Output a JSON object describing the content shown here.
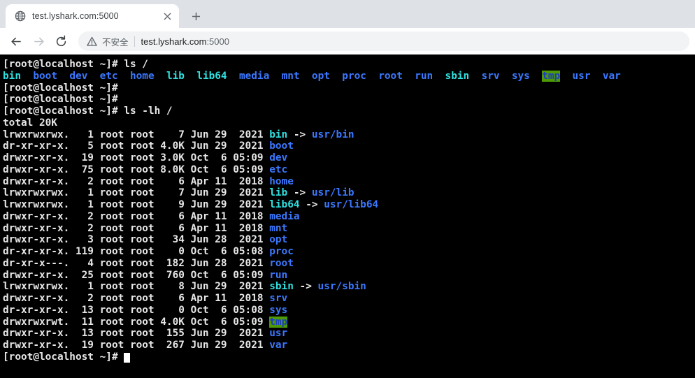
{
  "browser": {
    "tab": {
      "title": "test.lyshark.com:5000",
      "favicon": "globe-icon",
      "close": "close-icon"
    },
    "new_tab_label": "+",
    "nav": {
      "back": "back-arrow-icon",
      "forward": "forward-arrow-icon",
      "reload": "reload-icon"
    },
    "omnibox": {
      "security_icon": "warning-triangle-icon",
      "security_text": "不安全",
      "url_host": "test.lyshark.com",
      "url_port": ":5000",
      "url_full": "test.lyshark.com:5000"
    }
  },
  "terminal": {
    "prompt": "[root@localhost ~]# ",
    "cursor": "block-cursor",
    "background": "#000000",
    "colors": {
      "text": "#e6e6e6",
      "directory": "#3b78ff",
      "symlink": "#2ee0e0",
      "sticky_dir_fg": "#1c3fbf",
      "sticky_dir_bg": "#4e9a06"
    },
    "lines": [
      {
        "type": "prompt",
        "command": "ls /"
      },
      {
        "type": "ls-columns",
        "entries": [
          {
            "name": "bin",
            "kind": "symlink"
          },
          {
            "name": "boot",
            "kind": "dir"
          },
          {
            "name": "dev",
            "kind": "dir"
          },
          {
            "name": "etc",
            "kind": "dir"
          },
          {
            "name": "home",
            "kind": "dir"
          },
          {
            "name": "lib",
            "kind": "symlink"
          },
          {
            "name": "lib64",
            "kind": "symlink"
          },
          {
            "name": "media",
            "kind": "dir"
          },
          {
            "name": "mnt",
            "kind": "dir"
          },
          {
            "name": "opt",
            "kind": "dir"
          },
          {
            "name": "proc",
            "kind": "dir"
          },
          {
            "name": "root",
            "kind": "dir"
          },
          {
            "name": "run",
            "kind": "dir"
          },
          {
            "name": "sbin",
            "kind": "symlink"
          },
          {
            "name": "srv",
            "kind": "dir"
          },
          {
            "name": "sys",
            "kind": "dir"
          },
          {
            "name": "tmp",
            "kind": "sticky"
          },
          {
            "name": "usr",
            "kind": "dir"
          },
          {
            "name": "var",
            "kind": "dir"
          }
        ]
      },
      {
        "type": "prompt",
        "command": ""
      },
      {
        "type": "prompt",
        "command": ""
      },
      {
        "type": "prompt",
        "command": "ls -lh /"
      },
      {
        "type": "plain",
        "text": "total 20K"
      },
      {
        "type": "ls-long",
        "perms": "lrwxrwxrwx.",
        "links": "1",
        "owner": "root",
        "group": "root",
        "size": "7",
        "month": "Jun",
        "day": "29",
        "time": "2021",
        "name": "bin",
        "kind": "symlink",
        "target": "usr/bin"
      },
      {
        "type": "ls-long",
        "perms": "dr-xr-xr-x.",
        "links": "5",
        "owner": "root",
        "group": "root",
        "size": "4.0K",
        "month": "Jun",
        "day": "29",
        "time": "2021",
        "name": "boot",
        "kind": "dir"
      },
      {
        "type": "ls-long",
        "perms": "drwxr-xr-x.",
        "links": "19",
        "owner": "root",
        "group": "root",
        "size": "3.0K",
        "month": "Oct",
        "day": "6",
        "time": "05:09",
        "name": "dev",
        "kind": "dir"
      },
      {
        "type": "ls-long",
        "perms": "drwxr-xr-x.",
        "links": "75",
        "owner": "root",
        "group": "root",
        "size": "8.0K",
        "month": "Oct",
        "day": "6",
        "time": "05:09",
        "name": "etc",
        "kind": "dir"
      },
      {
        "type": "ls-long",
        "perms": "drwxr-xr-x.",
        "links": "2",
        "owner": "root",
        "group": "root",
        "size": "6",
        "month": "Apr",
        "day": "11",
        "time": "2018",
        "name": "home",
        "kind": "dir"
      },
      {
        "type": "ls-long",
        "perms": "lrwxrwxrwx.",
        "links": "1",
        "owner": "root",
        "group": "root",
        "size": "7",
        "month": "Jun",
        "day": "29",
        "time": "2021",
        "name": "lib",
        "kind": "symlink",
        "target": "usr/lib"
      },
      {
        "type": "ls-long",
        "perms": "lrwxrwxrwx.",
        "links": "1",
        "owner": "root",
        "group": "root",
        "size": "9",
        "month": "Jun",
        "day": "29",
        "time": "2021",
        "name": "lib64",
        "kind": "symlink",
        "target": "usr/lib64"
      },
      {
        "type": "ls-long",
        "perms": "drwxr-xr-x.",
        "links": "2",
        "owner": "root",
        "group": "root",
        "size": "6",
        "month": "Apr",
        "day": "11",
        "time": "2018",
        "name": "media",
        "kind": "dir"
      },
      {
        "type": "ls-long",
        "perms": "drwxr-xr-x.",
        "links": "2",
        "owner": "root",
        "group": "root",
        "size": "6",
        "month": "Apr",
        "day": "11",
        "time": "2018",
        "name": "mnt",
        "kind": "dir"
      },
      {
        "type": "ls-long",
        "perms": "drwxr-xr-x.",
        "links": "3",
        "owner": "root",
        "group": "root",
        "size": "34",
        "month": "Jun",
        "day": "28",
        "time": "2021",
        "name": "opt",
        "kind": "dir"
      },
      {
        "type": "ls-long",
        "perms": "dr-xr-xr-x.",
        "links": "119",
        "owner": "root",
        "group": "root",
        "size": "0",
        "month": "Oct",
        "day": "6",
        "time": "05:08",
        "name": "proc",
        "kind": "dir"
      },
      {
        "type": "ls-long",
        "perms": "dr-xr-x---.",
        "links": "4",
        "owner": "root",
        "group": "root",
        "size": "182",
        "month": "Jun",
        "day": "28",
        "time": "2021",
        "name": "root",
        "kind": "dir"
      },
      {
        "type": "ls-long",
        "perms": "drwxr-xr-x.",
        "links": "25",
        "owner": "root",
        "group": "root",
        "size": "760",
        "month": "Oct",
        "day": "6",
        "time": "05:09",
        "name": "run",
        "kind": "dir"
      },
      {
        "type": "ls-long",
        "perms": "lrwxrwxrwx.",
        "links": "1",
        "owner": "root",
        "group": "root",
        "size": "8",
        "month": "Jun",
        "day": "29",
        "time": "2021",
        "name": "sbin",
        "kind": "symlink",
        "target": "usr/sbin"
      },
      {
        "type": "ls-long",
        "perms": "drwxr-xr-x.",
        "links": "2",
        "owner": "root",
        "group": "root",
        "size": "6",
        "month": "Apr",
        "day": "11",
        "time": "2018",
        "name": "srv",
        "kind": "dir"
      },
      {
        "type": "ls-long",
        "perms": "dr-xr-xr-x.",
        "links": "13",
        "owner": "root",
        "group": "root",
        "size": "0",
        "month": "Oct",
        "day": "6",
        "time": "05:08",
        "name": "sys",
        "kind": "dir"
      },
      {
        "type": "ls-long",
        "perms": "drwxrwxrwt.",
        "links": "11",
        "owner": "root",
        "group": "root",
        "size": "4.0K",
        "month": "Oct",
        "day": "6",
        "time": "05:09",
        "name": "tmp",
        "kind": "sticky"
      },
      {
        "type": "ls-long",
        "perms": "drwxr-xr-x.",
        "links": "13",
        "owner": "root",
        "group": "root",
        "size": "155",
        "month": "Jun",
        "day": "29",
        "time": "2021",
        "name": "usr",
        "kind": "dir"
      },
      {
        "type": "ls-long",
        "perms": "drwxr-xr-x.",
        "links": "19",
        "owner": "root",
        "group": "root",
        "size": "267",
        "month": "Jun",
        "day": "29",
        "time": "2021",
        "name": "var",
        "kind": "dir"
      },
      {
        "type": "prompt-cursor",
        "command": ""
      }
    ]
  }
}
